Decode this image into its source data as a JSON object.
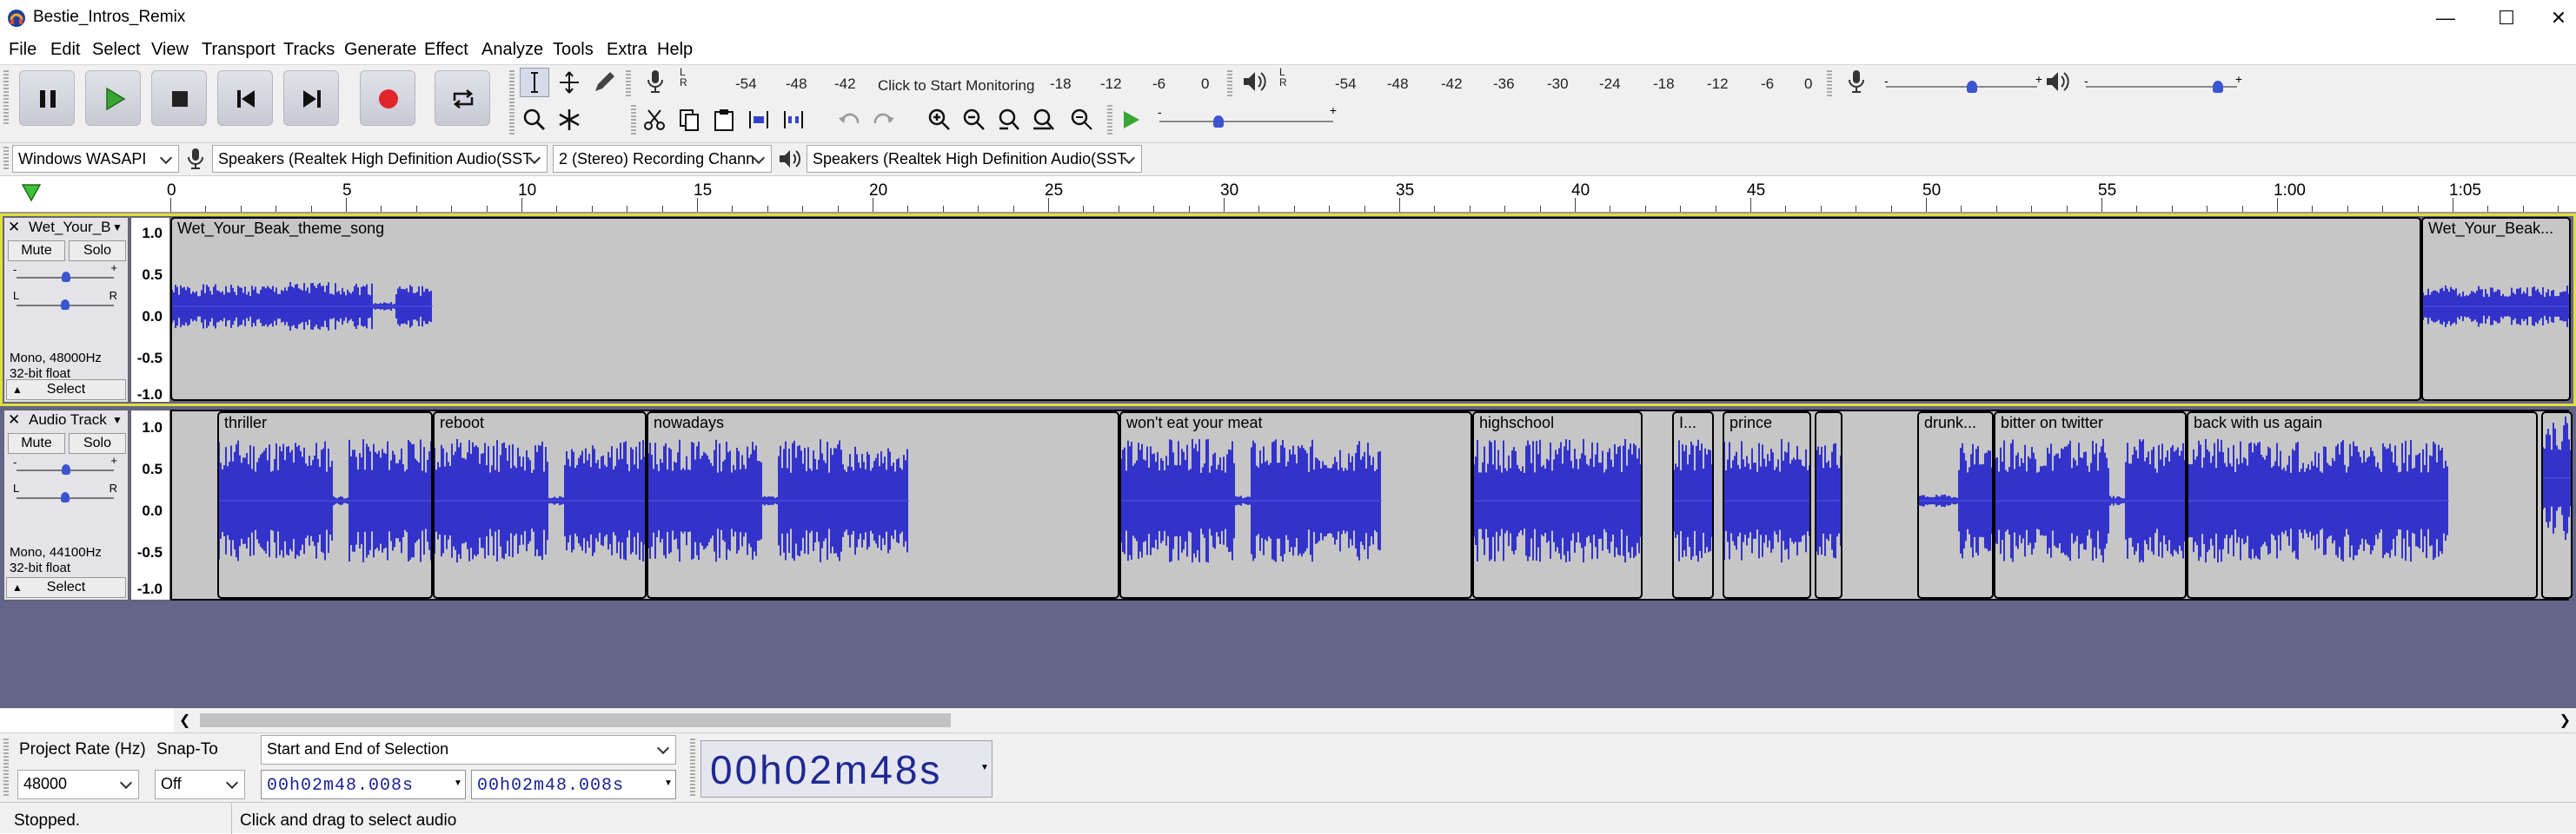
{
  "window": {
    "title": "Bestie_Intros_Remix"
  },
  "menu": [
    "File",
    "Edit",
    "Select",
    "View",
    "Transport",
    "Tracks",
    "Generate",
    "Effect",
    "Analyze",
    "Tools",
    "Extra",
    "Help"
  ],
  "transport": {
    "icons": [
      "pause-icon",
      "play-icon",
      "stop-icon",
      "skip-to-start-icon",
      "skip-to-end-icon",
      "record-icon",
      "loop-icon"
    ]
  },
  "tools": {
    "icons": [
      "selection-tool-icon",
      "envelope-tool-icon",
      "draw-tool-icon",
      "zoom-tool-icon",
      "multi-tool-icon"
    ]
  },
  "meters": {
    "record_scale": [
      "-54",
      "-48",
      "-42",
      "-18",
      "-12",
      "-6",
      "0"
    ],
    "record_hint": "Click to Start Monitoring",
    "play_scale": [
      "-54",
      "-48",
      "-42",
      "-36",
      "-30",
      "-24",
      "-18",
      "-12",
      "-6",
      "0"
    ],
    "lr": [
      "L",
      "R"
    ]
  },
  "mixer": {
    "record_volume": 0.7,
    "playback_volume": 1.0,
    "play_speed": 0.33
  },
  "devices": {
    "host": "Windows WASAPI",
    "recording_device": "Speakers (Realtek High Definition Audio(SST",
    "channels": "2 (Stereo) Recording Chann",
    "playback_device": "Speakers (Realtek High Definition Audio(SST"
  },
  "ruler": {
    "labels": [
      "0",
      "5",
      "10",
      "15",
      "20",
      "25",
      "30",
      "35",
      "40",
      "45",
      "50",
      "55",
      "1:00",
      "1:05"
    ]
  },
  "tracks": [
    {
      "name": "Wet_Your_B",
      "mute": "Mute",
      "solo": "Solo",
      "pan_lr": [
        "L",
        "R"
      ],
      "format": "Mono, 48000Hz",
      "bitdepth": "32-bit float",
      "select": "Select",
      "scale": [
        "1.0",
        "0.5",
        "0.0",
        "-0.5",
        "-1.0"
      ],
      "clips": [
        {
          "name": "Wet_Your_Beak_theme_song"
        },
        {
          "name": "Wet_Your_Beak..."
        }
      ]
    },
    {
      "name": "Audio Track",
      "mute": "Mute",
      "solo": "Solo",
      "pan_lr": [
        "L",
        "R"
      ],
      "format": "Mono, 44100Hz",
      "bitdepth": "32-bit float",
      "select": "Select",
      "scale": [
        "1.0",
        "0.5",
        "0.0",
        "-0.5",
        "-1.0"
      ],
      "clips": [
        {
          "name": "thriller"
        },
        {
          "name": "reboot"
        },
        {
          "name": "nowadays"
        },
        {
          "name": "won't eat your meat"
        },
        {
          "name": "highschool"
        },
        {
          "name": "I..."
        },
        {
          "name": "prince"
        },
        {
          "name": ""
        },
        {
          "name": "drunk..."
        },
        {
          "name": "bitter on twitter"
        },
        {
          "name": "back with us again"
        }
      ]
    }
  ],
  "selection_toolbar": {
    "project_rate_label": "Project Rate (Hz)",
    "project_rate": "48000",
    "snap_label": "Snap-To",
    "snap_value": "Off",
    "selection_mode": "Start and End of Selection",
    "start": "00h02m48.008s",
    "end": "00h02m48.008s",
    "big_time": "00h02m48s"
  },
  "status": {
    "state": "Stopped.",
    "hint": "Click and drag to select audio"
  }
}
